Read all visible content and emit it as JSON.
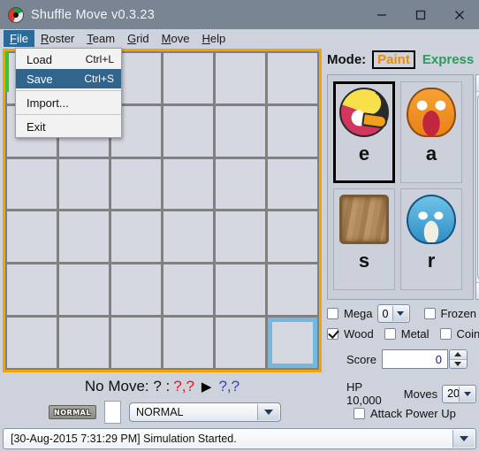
{
  "window": {
    "title": "Shuffle Move v0.3.23",
    "icon": "pokeball-icon",
    "minimize_label": "Minimize",
    "maximize_label": "Maximize",
    "close_label": "Close"
  },
  "menubar": {
    "items": [
      {
        "label": "File",
        "mnemonic": "F",
        "active": true
      },
      {
        "label": "Roster",
        "mnemonic": "R",
        "active": false
      },
      {
        "label": "Team",
        "mnemonic": "T",
        "active": false
      },
      {
        "label": "Grid",
        "mnemonic": "G",
        "active": false
      },
      {
        "label": "Move",
        "mnemonic": "M",
        "active": false
      },
      {
        "label": "Help",
        "mnemonic": "H",
        "active": false
      }
    ]
  },
  "file_menu": {
    "open": true,
    "items": [
      {
        "label": "Load",
        "accel": "Ctrl+L",
        "selected": false,
        "separator_after": false
      },
      {
        "label": "Save",
        "accel": "Ctrl+S",
        "selected": true,
        "separator_after": true
      },
      {
        "label": "Import...",
        "accel": "",
        "selected": false,
        "separator_after": true
      },
      {
        "label": "Exit",
        "accel": "",
        "selected": false,
        "separator_after": false
      }
    ]
  },
  "board": {
    "rows": 6,
    "columns": 6,
    "border_color": "#f5a300",
    "cell_color": "#d5d8e0",
    "gridline_color": "#808080",
    "selected_cell": {
      "row": 6,
      "column": 6
    },
    "selection_color": "#72b8e0",
    "accent_strip_color": "#3fc127",
    "cells": [
      [
        "",
        "",
        "",
        "",
        "",
        ""
      ],
      [
        "",
        "",
        "",
        "",
        "",
        ""
      ],
      [
        "",
        "",
        "",
        "",
        "",
        ""
      ],
      [
        "",
        "",
        "",
        "",
        "",
        ""
      ],
      [
        "",
        "",
        "",
        "",
        "",
        ""
      ],
      [
        "",
        "",
        "",
        "",
        "",
        ""
      ]
    ]
  },
  "move_info": {
    "prefix": "No Move: ? :",
    "from": "?,?",
    "arrow": "▶",
    "to": "?,?",
    "from_color": "#e8161d",
    "to_color": "#3c3cc8"
  },
  "type_row": {
    "badge": "NORMAL",
    "swatch_color": "#ffffff",
    "select_value": "NORMAL"
  },
  "mode": {
    "label": "Mode:",
    "paint": "Paint",
    "express": "Express",
    "active": "Paint",
    "paint_color": "#f08a00",
    "express_color": "#2d9a5f"
  },
  "species": {
    "entries": [
      {
        "letter": "e",
        "art": "bird-icon",
        "selected": true
      },
      {
        "letter": "a",
        "art": "dragon-icon",
        "selected": false
      },
      {
        "letter": "s",
        "art": "wood-icon",
        "selected": false
      },
      {
        "letter": "r",
        "art": "turtle-icon",
        "selected": false
      }
    ],
    "scrollbar": {
      "up": "▲",
      "down": "▼"
    }
  },
  "options": {
    "mega": {
      "label": "Mega",
      "checked": false,
      "value": "0"
    },
    "frozen": {
      "label": "Frozen",
      "checked": false
    },
    "wood": {
      "label": "Wood",
      "checked": true
    },
    "metal": {
      "label": "Metal",
      "checked": false
    },
    "coin": {
      "label": "Coin",
      "checked": false
    },
    "score": {
      "label": "Score",
      "value": "0"
    }
  },
  "stage": {
    "hp_label": "HP 10,000",
    "moves_label": "Moves",
    "moves_value": "20",
    "attack_power_up": {
      "label": "Attack Power Up",
      "checked": false
    }
  },
  "statusbar": {
    "message": "[30-Aug-2015 7:31:29 PM] Simulation Started."
  }
}
